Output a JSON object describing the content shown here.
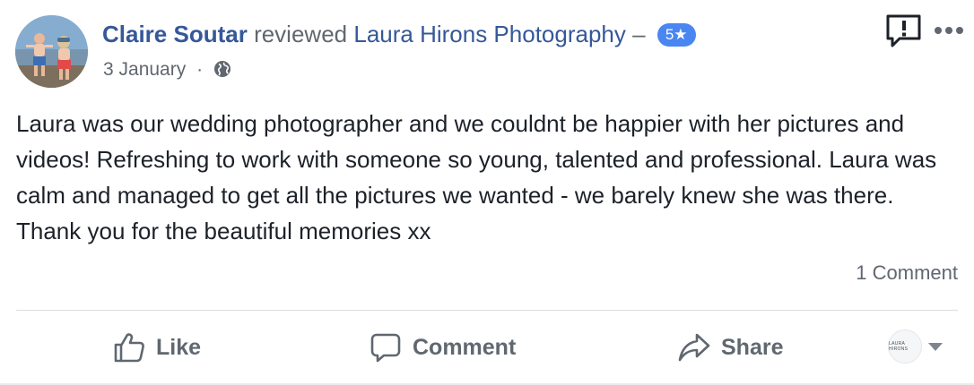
{
  "post": {
    "author": "Claire Soutar",
    "verb": "reviewed",
    "page_name": "Laura Hirons Photography",
    "dash": "–",
    "rating": "5",
    "rating_star": "★",
    "date": "3 January",
    "meta_separator": "·",
    "privacy_icon": "globe-icon",
    "text": "Laura was our wedding photographer and we couldnt be happier with her pictures and videos! Refreshing to work with someone so young, talented and professional. Laura was calm and managed to get all the pictures we wanted - we barely knew she was there. Thank you for the beautiful memories xx",
    "comment_count": "1 Comment"
  },
  "actions": {
    "like": "Like",
    "comment": "Comment",
    "share": "Share"
  },
  "reactor": {
    "avatar_text": "LAURA HIRONS"
  },
  "colors": {
    "link": "#365899",
    "badge": "#4a86f1",
    "muted": "#616770",
    "text": "#1d2129"
  }
}
